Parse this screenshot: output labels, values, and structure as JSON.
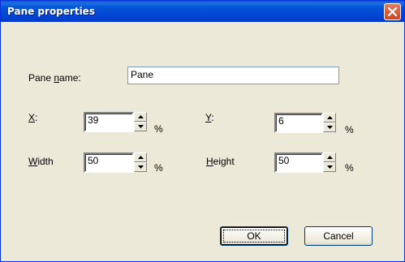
{
  "window": {
    "title": "Pane properties",
    "close_icon": "close-icon"
  },
  "fields": {
    "pane_name": {
      "label_pre": "Pane ",
      "label_acc": "n",
      "label_post": "ame:",
      "value": "Pane"
    },
    "x": {
      "label_acc": "X",
      "label_post": ":",
      "value": "39",
      "unit": "%"
    },
    "y": {
      "label_acc": "Y",
      "label_post": ":",
      "value": "6",
      "unit": "%"
    },
    "width": {
      "label_acc": "W",
      "label_post": "idth",
      "value": "50",
      "unit": "%"
    },
    "height": {
      "label_acc": "H",
      "label_post": "eight",
      "value": "50",
      "unit": "%"
    }
  },
  "buttons": {
    "ok": "OK",
    "cancel": "Cancel"
  },
  "colors": {
    "titlebar": "#0046d5",
    "dialog_bg": "#ece9d8",
    "close_button": "#d1441c"
  }
}
